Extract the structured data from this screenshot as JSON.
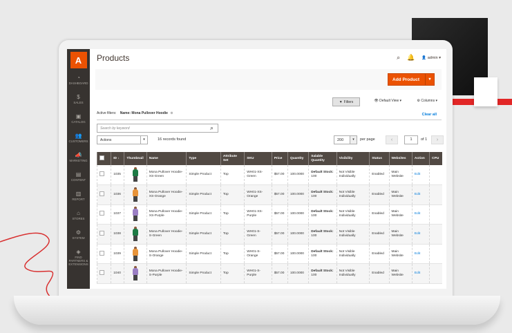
{
  "sidebar": {
    "logo": "A",
    "items": [
      {
        "icon": "gauge-icon",
        "glyph": "◔",
        "label": "DASHBOARD"
      },
      {
        "icon": "dollar-icon",
        "glyph": "$",
        "label": "SALES"
      },
      {
        "icon": "cube-icon",
        "glyph": "▣",
        "label": "CATALOG"
      },
      {
        "icon": "customers-icon",
        "glyph": "👥",
        "label": "CUSTOMERS"
      },
      {
        "icon": "megaphone-icon",
        "glyph": "📣",
        "label": "MARKETING"
      },
      {
        "icon": "content-icon",
        "glyph": "▤",
        "label": "CONTENT"
      },
      {
        "icon": "bar-chart-icon",
        "glyph": "▥",
        "label": "REPORT"
      },
      {
        "icon": "store-icon",
        "glyph": "⌂",
        "label": "STORES"
      },
      {
        "icon": "gear-icon",
        "glyph": "⚙",
        "label": "SYSTEM"
      },
      {
        "icon": "extensions-icon",
        "glyph": "◈",
        "label": "FIND PARTNERS & EXTENSIONS"
      }
    ]
  },
  "header": {
    "title": "Products",
    "user": "admin",
    "add_product": "Add Product"
  },
  "toolbar": {
    "filters": "Filters",
    "view": "Default View",
    "columns": "Columns",
    "active_filters_label": "Active filters:",
    "active_filter": "Name: Mona Pullover Hoodie",
    "clear_all": "Clear all",
    "search_placeholder": "Search by keyword",
    "actions": "Actions",
    "records": "16 records found",
    "per_page": "200",
    "per_page_label": "per page",
    "page": "1",
    "of_pages": "of 1"
  },
  "columns": [
    "ID",
    "Thumbnail",
    "Name",
    "Type",
    "Attribute Set",
    "SKU",
    "Price",
    "Quantity",
    "Salable Quantity",
    "Visibility",
    "Status",
    "Websites",
    "Action",
    "CPU"
  ],
  "rows": [
    {
      "id": "1035",
      "color": "#1e7a45",
      "name": "Mona Pullover Hoodie-XS-Green",
      "type": "Simple Product",
      "attr": "Top",
      "sku": "WH01-XS-Green",
      "price": "$57.00",
      "qty": "100.0000",
      "salable_label": "Default Stock:",
      "salable": "100",
      "visibility": "Not Visible Individually",
      "status": "Enabled",
      "websites": "Main Website",
      "action": "Edit"
    },
    {
      "id": "1036",
      "color": "#e8943a",
      "name": "Mona Pullover Hoodie-XS-Orange",
      "type": "Simple Product",
      "attr": "Top",
      "sku": "WH01-XS-Orange",
      "price": "$57.00",
      "qty": "100.0000",
      "salable_label": "Default Stock:",
      "salable": "100",
      "visibility": "Not Visible Individually",
      "status": "Enabled",
      "websites": "Main Website",
      "action": "Edit"
    },
    {
      "id": "1037",
      "color": "#9b7fc4",
      "name": "Mona Pullover Hoodie-XS-Purple",
      "type": "Simple Product",
      "attr": "Top",
      "sku": "WH01-XS-Purple",
      "price": "$57.00",
      "qty": "100.0000",
      "salable_label": "Default Stock:",
      "salable": "100",
      "visibility": "Not Visible Individually",
      "status": "Enabled",
      "websites": "Main Website",
      "action": "Edit"
    },
    {
      "id": "1038",
      "color": "#1e7a45",
      "name": "Mona Pullover Hoodie-S-Green",
      "type": "Simple Product",
      "attr": "Top",
      "sku": "WH01-S-Green",
      "price": "$57.00",
      "qty": "100.0000",
      "salable_label": "Default Stock:",
      "salable": "100",
      "visibility": "Not Visible Individually",
      "status": "Enabled",
      "websites": "Main Website",
      "action": "Edit"
    },
    {
      "id": "1039",
      "color": "#e8943a",
      "name": "Mona Pullover Hoodie-S-Orange",
      "type": "Simple Product",
      "attr": "Top",
      "sku": "WH01-S-Orange",
      "price": "$57.00",
      "qty": "100.0000",
      "salable_label": "Default Stock:",
      "salable": "100",
      "visibility": "Not Visible Individually",
      "status": "Enabled",
      "websites": "Main Website",
      "action": "Edit"
    },
    {
      "id": "1040",
      "color": "#9b7fc4",
      "name": "Mona Pullover Hoodie-S-Purple",
      "type": "Simple Product",
      "attr": "Top",
      "sku": "WH01-S-Purple",
      "price": "$57.00",
      "qty": "100.0000",
      "salable_label": "Default Stock:",
      "salable": "100",
      "visibility": "Not Visible Individually",
      "status": "Enabled",
      "websites": "Main Website",
      "action": "Edit"
    }
  ],
  "colors": {
    "accent": "#eb5202",
    "sidebar": "#373330",
    "header": "#514943",
    "link": "#007bdb"
  }
}
